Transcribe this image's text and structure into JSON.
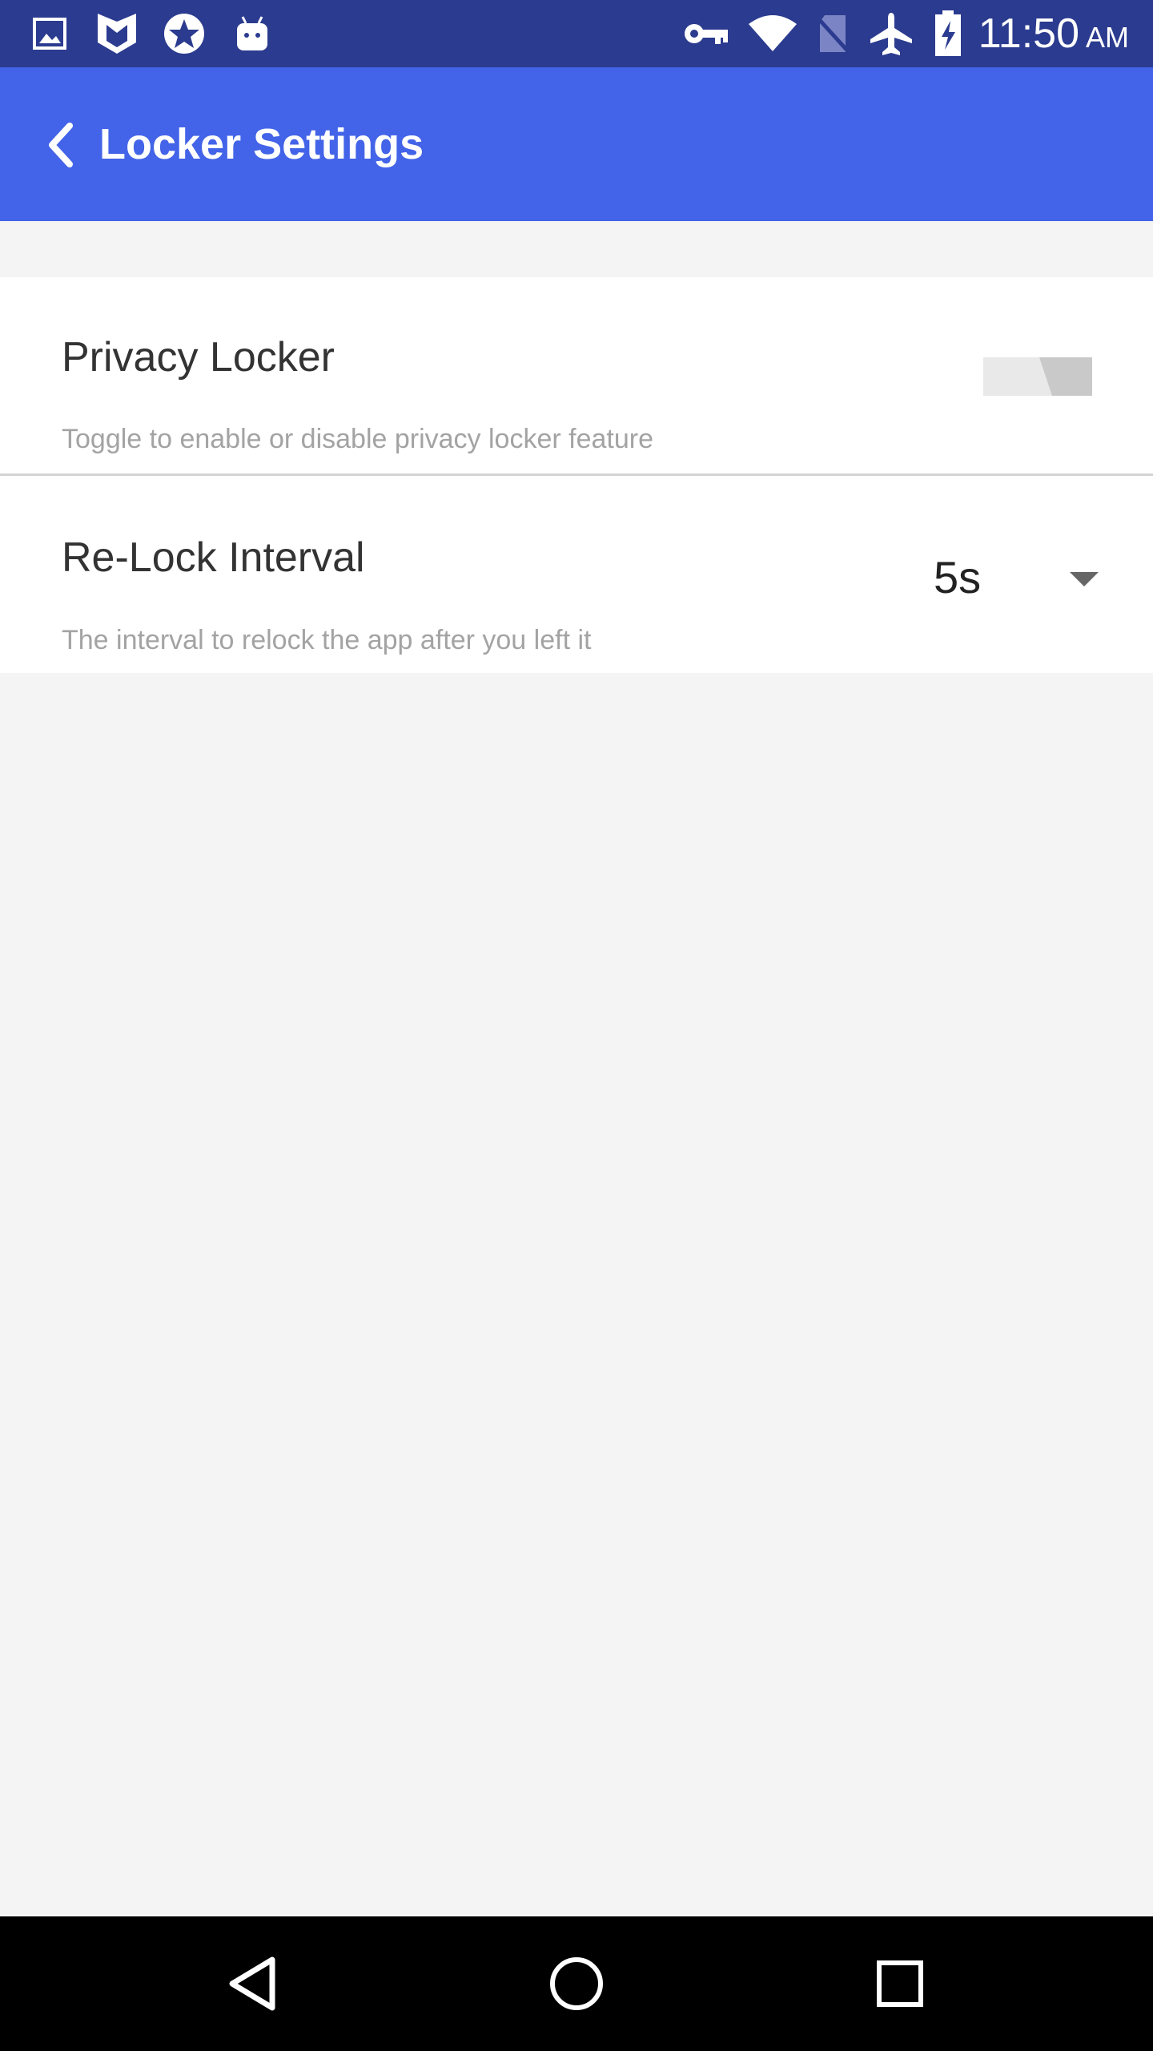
{
  "status_bar": {
    "time": "11:50",
    "ampm": "AM",
    "icons": [
      "image-icon",
      "shield-m-icon",
      "star-badge-icon",
      "android-icon",
      "key-icon",
      "wifi-icon",
      "no-sim-icon",
      "airplane-icon",
      "battery-charging-icon"
    ]
  },
  "app_bar": {
    "title": "Locker Settings",
    "back_icon": "chevron-left-icon",
    "background": "#4364e8"
  },
  "settings": {
    "privacy_locker": {
      "title": "Privacy Locker",
      "description": "Toggle to enable or disable privacy locker feature",
      "enabled": false
    },
    "relock_interval": {
      "title": "Re-Lock Interval",
      "description": "The interval to relock the app after you left it",
      "value": "5s"
    }
  },
  "nav_bar": {
    "buttons": [
      "back-triangle-icon",
      "home-circle-icon",
      "recents-square-icon"
    ]
  }
}
